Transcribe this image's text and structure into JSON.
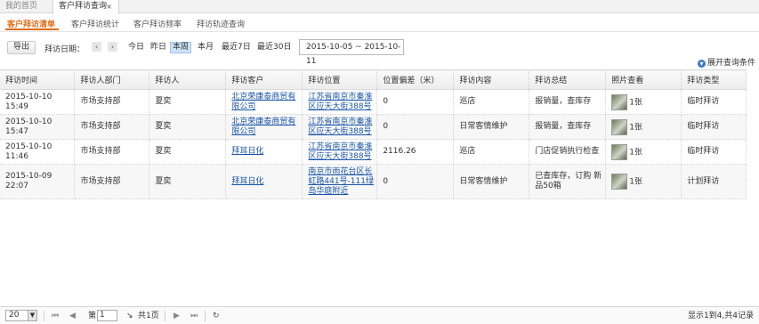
{
  "top_tabs": [
    {
      "label": "我的首页"
    },
    {
      "label": "客户拜访查询",
      "close": "×"
    }
  ],
  "sub_tabs": [
    {
      "label": "客户拜访清单",
      "active": true
    },
    {
      "label": "客户拜访统计"
    },
    {
      "label": "客户拜访频率"
    },
    {
      "label": "拜访轨迹查询"
    }
  ],
  "toolbar": {
    "export_label": "导出",
    "date_label": "拜访日期：",
    "prev": "‹",
    "next": "›",
    "quick": [
      "今日",
      "昨日",
      "本周",
      "本月",
      "最近7日",
      "最近30日"
    ],
    "selected_quick": "本周",
    "date_range": "2015-10-05 ~ 2015-10-11",
    "expand_label": "展开查询条件"
  },
  "table": {
    "headers": [
      "拜访时间",
      "拜访人部门",
      "拜访人",
      "拜访客户",
      "拜访位置",
      "位置偏差（米）",
      "拜访内容",
      "拜访总结",
      "照片查看",
      "拜访类型"
    ],
    "rows": [
      {
        "time": "2015-10-10 15:49",
        "dept": "市场支持部",
        "person": "夏奕",
        "customer": [
          "北京荣康泰商贸有",
          "限公司"
        ],
        "location": [
          "江苏省南京市秦淮",
          "区应天大街388号"
        ],
        "deviation": "0",
        "content": "巡店",
        "summary": [
          "报销量，查库存"
        ],
        "photos": "1张",
        "type": "临时拜访"
      },
      {
        "time": "2015-10-10 15:47",
        "dept": "市场支持部",
        "person": "夏奕",
        "customer": [
          "北京荣康泰商贸有",
          "限公司"
        ],
        "location": [
          "江苏省南京市秦淮",
          "区应天大街388号"
        ],
        "deviation": "0",
        "content": "日常客情维护",
        "summary": [
          "报销量，查库存"
        ],
        "photos": "1张",
        "type": "临时拜访"
      },
      {
        "time": "2015-10-10 11:46",
        "dept": "市场支持部",
        "person": "夏奕",
        "customer": [
          "拜耳日化"
        ],
        "location": [
          "江苏省南京市秦淮",
          "区应天大街388号"
        ],
        "deviation": "2116.26",
        "deviation_color": "#d43b2f",
        "content": "巡店",
        "summary": [
          "门店促销执行检查"
        ],
        "photos": "1张",
        "type": "临时拜访"
      },
      {
        "time": "2015-10-09 22:07",
        "dept": "市场支持部",
        "person": "夏奕",
        "customer": [
          "拜耳日化"
        ],
        "location": [
          "南京市雨花台区长",
          "虹路441号-111绿",
          "岛华庭附近"
        ],
        "deviation": "0",
        "content": "日常客情维护",
        "summary": [
          "已查库存，订购 新",
          "品50箱"
        ],
        "photos": "1张",
        "type": "计划拜访"
      }
    ]
  },
  "pager": {
    "page_size": "20",
    "page_prefix": "第",
    "page": "1",
    "page_total": "共1页",
    "summary": "显示1到4,共4记录"
  },
  "colors": {
    "accent": "#e56b14",
    "link": "#1a56a8",
    "selected_bg": "#cfe3f7",
    "warn": "#d43b2f"
  }
}
